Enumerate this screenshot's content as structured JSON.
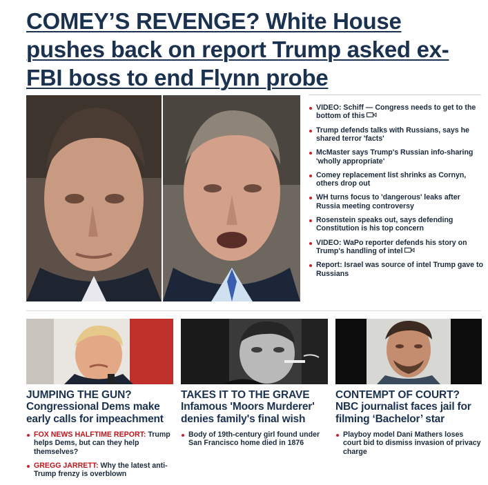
{
  "main_story": {
    "headline": "COMEY’S REVENGE? White House pushes back on report Trump asked ex-FBI boss to end Flynn probe",
    "left_image_icon": "portrait-photo-icon",
    "right_image_icon": "portrait-photo-icon"
  },
  "related_links": [
    {
      "text": "VIDEO: Schiff — Congress needs to get to the bottom of this",
      "video": true
    },
    {
      "text": "Trump defends talks with Russians, says he shared terror 'facts'",
      "video": false
    },
    {
      "text": "McMaster says Trump's Russian info-sharing 'wholly appropriate'",
      "video": false
    },
    {
      "text": "Comey replacement list shrinks as Cornyn, others drop out",
      "video": false
    },
    {
      "text": "WH turns focus to 'dangerous' leaks after Russia meeting controversy",
      "video": false
    },
    {
      "text": "Rosenstein speaks out, says defending Constitution is his top concern",
      "video": false
    },
    {
      "text": "VIDEO: WaPo reporter defends his story on Trump's handling of intel",
      "video": true
    },
    {
      "text": "Report: Israel was source of intel Trump gave to Russians",
      "video": false
    }
  ],
  "cards": [
    {
      "kicker": "JUMPING THE GUN?",
      "deck": "Congressional Dems make early calls for impeachment",
      "links": [
        {
          "lead": "FOX NEWS HALFTIME REPORT:",
          "text": " Trump helps Dems, but can they help themselves?"
        },
        {
          "lead": "GREGG JARRETT:",
          "text": " Why the latest anti-Trump frenzy is overblown"
        }
      ]
    },
    {
      "kicker": "TAKES IT TO THE GRAVE",
      "deck": "Infamous 'Moors Murderer' denies family's final wish",
      "links": [
        {
          "lead": "",
          "text": "Body of 19th-century girl found under San Francisco home died in 1876"
        }
      ]
    },
    {
      "kicker": "CONTEMPT OF COURT?",
      "deck": "NBC journalist faces jail for filming ‘Bachelor’ star",
      "links": [
        {
          "lead": "",
          "text": "Playboy model Dani Mathers loses court bid to dismiss invasion of privacy charge"
        }
      ]
    }
  ],
  "colors": {
    "headline": "#1b3150",
    "bullet": "#cc2127",
    "red_lead": "#c0141b"
  },
  "icons": {
    "video": "video-camera-icon"
  }
}
